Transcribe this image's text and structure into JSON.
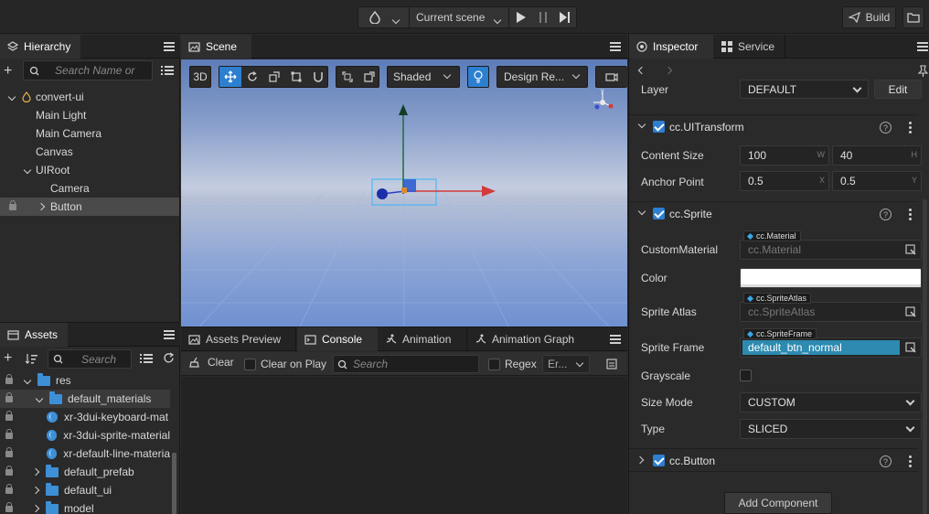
{
  "toolbar": {
    "scene_select": "Current scene",
    "build_label": "Build"
  },
  "hierarchy": {
    "tab": "Hierarchy",
    "search_placeholder": "Search Name or",
    "nodes": [
      {
        "label": "convert-ui"
      },
      {
        "label": "Main Light"
      },
      {
        "label": "Main Camera"
      },
      {
        "label": "Canvas"
      },
      {
        "label": "UIRoot"
      },
      {
        "label": "Camera"
      },
      {
        "label": "Button"
      }
    ]
  },
  "assets": {
    "tab": "Assets",
    "search_placeholder": "Search",
    "items": [
      {
        "label": "res"
      },
      {
        "label": "default_materials"
      },
      {
        "label": "xr-3dui-keyboard-mat"
      },
      {
        "label": "xr-3dui-sprite-material"
      },
      {
        "label": "xr-default-line-materia"
      },
      {
        "label": "default_prefab"
      },
      {
        "label": "default_ui"
      },
      {
        "label": "model"
      }
    ]
  },
  "scene": {
    "tab": "Scene",
    "mode_3d": "3D",
    "shading": "Shaded",
    "design_res": "Design Re..."
  },
  "bottom": {
    "tabs": [
      "Assets Preview",
      "Console",
      "Animation",
      "Animation Graph"
    ],
    "clear_label": "Clear",
    "clear_on_play": "Clear on Play",
    "search_placeholder": "Search",
    "regex_label": "Regex",
    "level_select": "Er..."
  },
  "inspector": {
    "tabs": [
      "Inspector",
      "Service"
    ],
    "layer_label": "Layer",
    "layer_value": "DEFAULT",
    "edit_label": "Edit",
    "uitransform": {
      "title": "cc.UITransform",
      "content_size_label": "Content Size",
      "width": "100",
      "width_axis": "W",
      "height": "40",
      "height_axis": "H",
      "anchor_label": "Anchor Point",
      "anchor_x": "0.5",
      "anchor_x_axis": "X",
      "anchor_y": "0.5",
      "anchor_y_axis": "Y"
    },
    "sprite": {
      "title": "cc.Sprite",
      "custom_material_label": "CustomMaterial",
      "material_tag": "cc.Material",
      "material_value": "cc.Material",
      "color_label": "Color",
      "color_value": "#ffffff",
      "atlas_label": "Sprite Atlas",
      "atlas_tag": "cc.SpriteAtlas",
      "atlas_value": "cc.SpriteAtlas",
      "frame_label": "Sprite Frame",
      "frame_tag": "cc.SpriteFrame",
      "frame_value": "default_btn_normal",
      "grayscale_label": "Grayscale",
      "size_mode_label": "Size Mode",
      "size_mode_value": "CUSTOM",
      "type_label": "Type",
      "type_value": "SLICED"
    },
    "button_comp": {
      "title": "cc.Button"
    },
    "add_component": "Add Component"
  },
  "colors": {
    "accent": "#2d7fd0",
    "selection_field": "#2d8ab0",
    "sky_top": "#5d7cb8",
    "gizmo_y": "#1f6b3a",
    "gizmo_x": "#d23b3b",
    "gizmo_z": "#2a3fbf"
  }
}
